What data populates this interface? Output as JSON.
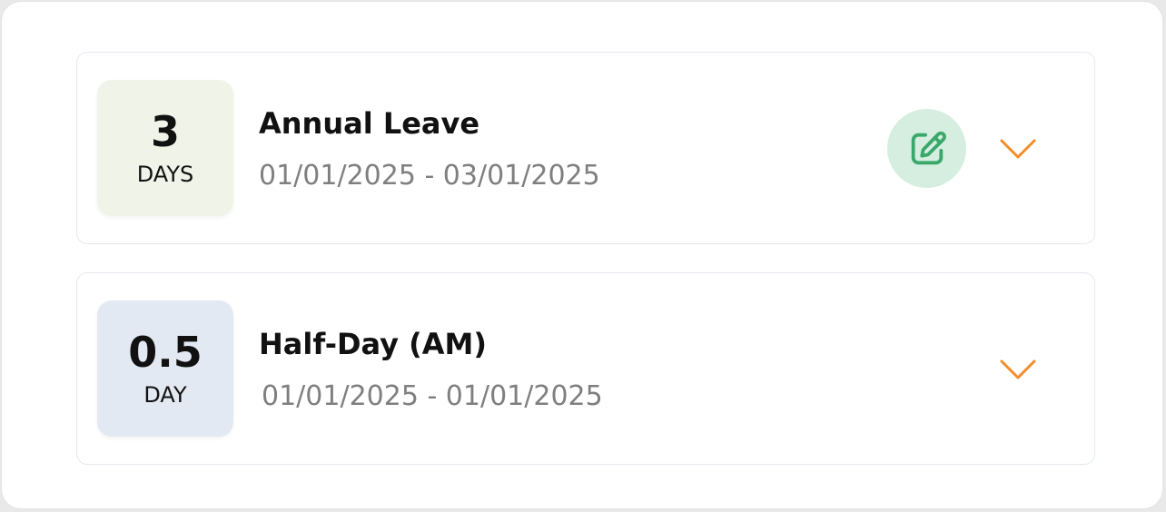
{
  "colors": {
    "accent_orange": "#f28c28",
    "edit_green": "#3aa86a",
    "edit_bg": "#d5eee0",
    "badge_green_bg": "#f0f4e8",
    "badge_blue_bg": "#e3e9f3"
  },
  "leaves": [
    {
      "count": "3",
      "unit": "DAYS",
      "title": "Annual Leave",
      "dates": "01/01/2025 - 03/01/2025",
      "icons": {
        "edit": "edit-icon",
        "expand": "chevron-down-icon"
      }
    },
    {
      "count": "0.5",
      "unit": "DAY",
      "title": "Half-Day (AM)",
      "dates": "01/01/2025 - 01/01/2025",
      "icons": {
        "expand": "chevron-down-icon"
      }
    }
  ]
}
